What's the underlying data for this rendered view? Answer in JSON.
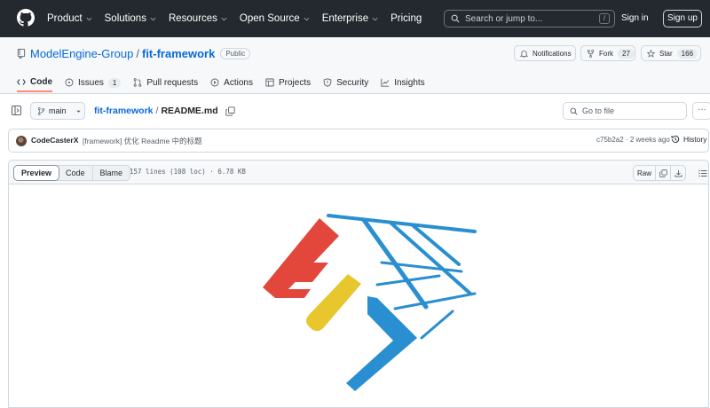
{
  "header": {
    "nav": [
      "Product",
      "Solutions",
      "Resources",
      "Open Source",
      "Enterprise",
      "Pricing"
    ],
    "search_placeholder": "Search or jump to...",
    "search_shortcut": "/",
    "sign_in": "Sign in",
    "sign_up": "Sign up"
  },
  "repo": {
    "owner": "ModelEngine-Group",
    "separator": "/",
    "name": "fit-framework",
    "visibility": "Public",
    "notifications_label": "Notifications",
    "fork_label": "Fork",
    "fork_count": "27",
    "star_label": "Star",
    "star_count": "166"
  },
  "tabs": [
    {
      "label": "Code",
      "active": true
    },
    {
      "label": "Issues",
      "count": "1"
    },
    {
      "label": "Pull requests"
    },
    {
      "label": "Actions"
    },
    {
      "label": "Projects"
    },
    {
      "label": "Security"
    },
    {
      "label": "Insights"
    }
  ],
  "file_nav": {
    "branch": "main",
    "path_repo": "fit-framework",
    "path_sep": "/",
    "path_file": "README.md",
    "goto_placeholder": "Go to file",
    "more": "···"
  },
  "commit": {
    "author": "CodeCasterX",
    "message": "[framework] 优化 Readme 中的标题",
    "sha": "c75b2a2",
    "time": "2 weeks ago",
    "meta_sep": "·",
    "history_label": "History"
  },
  "file_view": {
    "modes": [
      "Preview",
      "Code",
      "Blame"
    ],
    "active_mode": "Preview",
    "info": "157 lines (108 loc) · 6.78 KB",
    "raw_label": "Raw"
  },
  "colors": {
    "header_bg": "#24292f",
    "link": "#0969da",
    "tab_underline": "#fd8c73",
    "logo_red": "#e3473b",
    "logo_yellow": "#e8c62e",
    "logo_blue": "#2a8fd1"
  }
}
